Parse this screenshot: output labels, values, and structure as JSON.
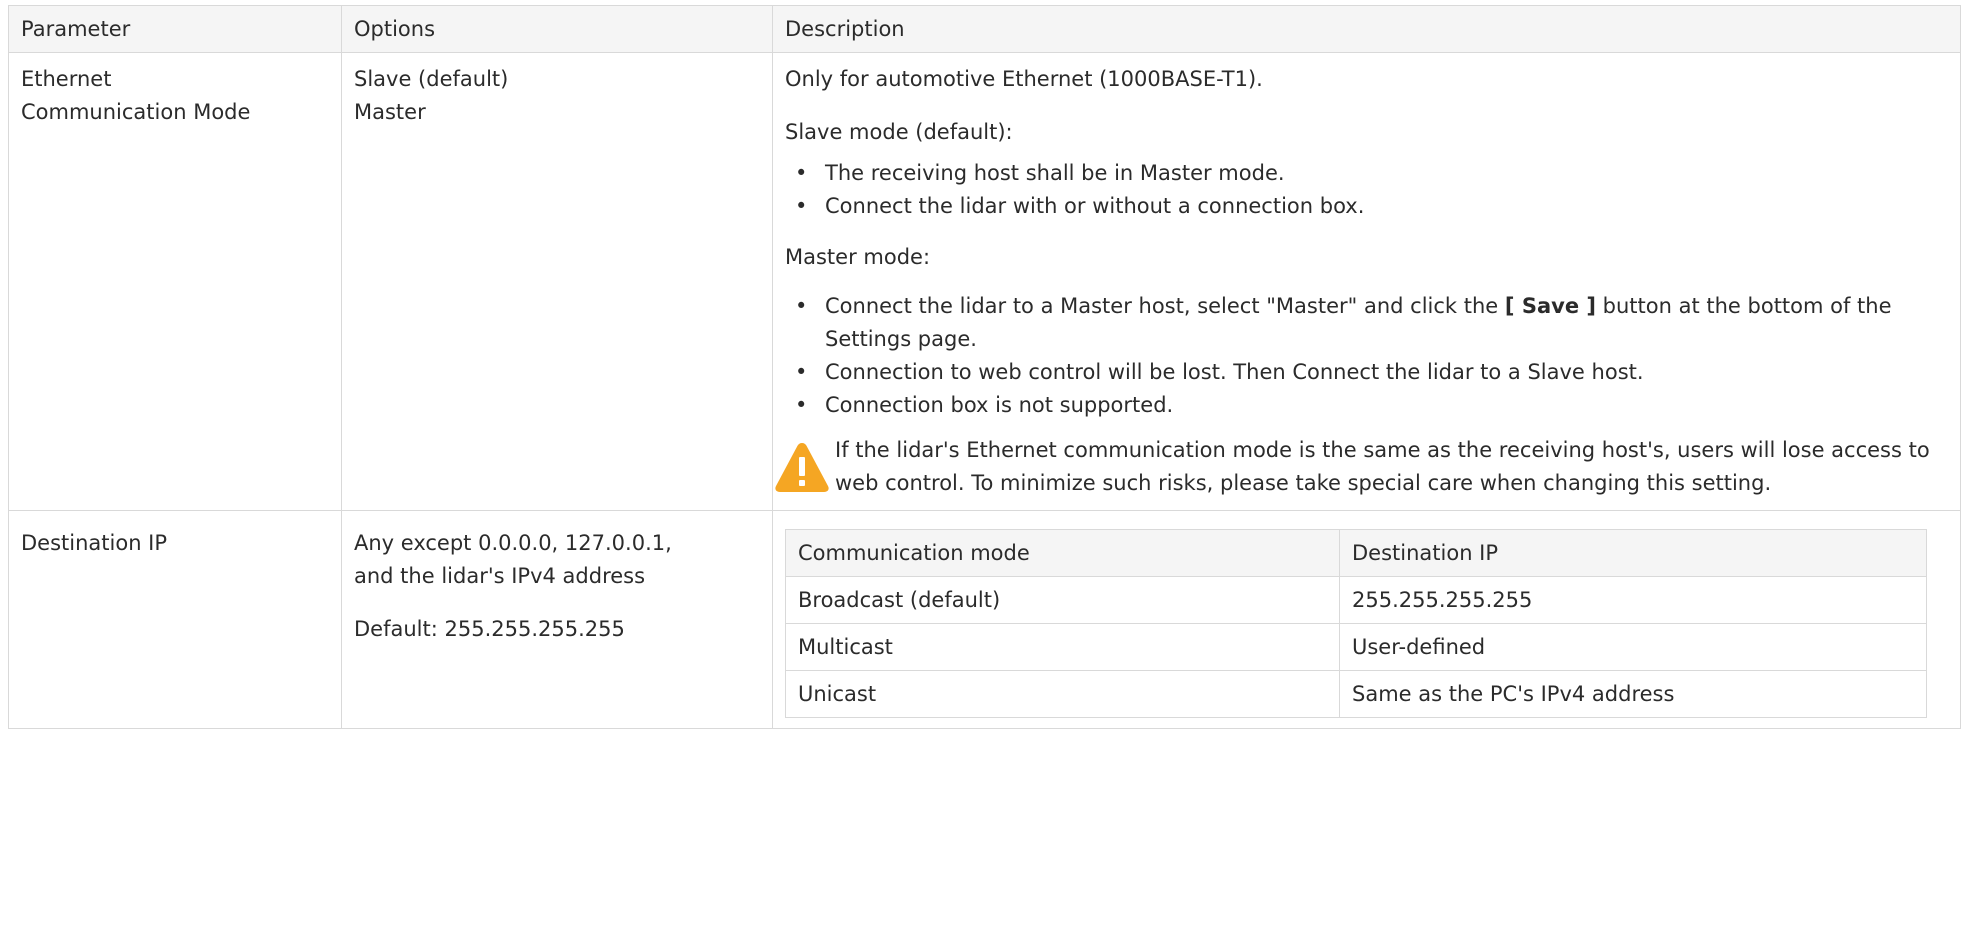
{
  "headers": [
    "Parameter",
    "Options",
    "Description"
  ],
  "ethernet": {
    "param": [
      "Ethernet",
      "Communication Mode"
    ],
    "options": [
      "Slave (default)",
      "Master"
    ],
    "intro": "Only for automotive Ethernet (1000BASE-T1).",
    "slave_heading": "Slave mode (default):",
    "slave_bullets": [
      "The receiving host shall be in Master mode.",
      "Connect the lidar with or without a connection box."
    ],
    "master_heading": "Master mode:",
    "master_b1_pre": "Connect the lidar to a Master host, select \"Master\" and click the",
    "master_b1_btn": "[ Save ]",
    "master_b1_post": "button at the bottom of the Settings page.",
    "master_b2": "Connection to web control will be lost. Then Connect the lidar to a Slave host.",
    "master_b3": "Connection box is not supported.",
    "bullet": "•",
    "warning_icon": "warning-triangle-icon",
    "warning_color": "#F5A623",
    "warning_text": "If the lidar's Ethernet communication mode is the same as the receiving host's, users will lose access to web control. To minimize such risks, please take special care when changing this setting."
  },
  "destination": {
    "param": "Destination IP",
    "options_line1": "Any except 0.0.0.0, 127.0.0.1,",
    "options_line2": "and the lidar's IPv4 address",
    "options_default": "Default: 255.255.255.255",
    "inner_headers": [
      "Communication mode",
      "Destination IP"
    ],
    "inner_rows": [
      [
        "Broadcast (default)",
        "255.255.255.255"
      ],
      [
        "Multicast",
        "User-defined"
      ],
      [
        "Unicast",
        "Same as the PC's IPv4 address"
      ]
    ]
  }
}
